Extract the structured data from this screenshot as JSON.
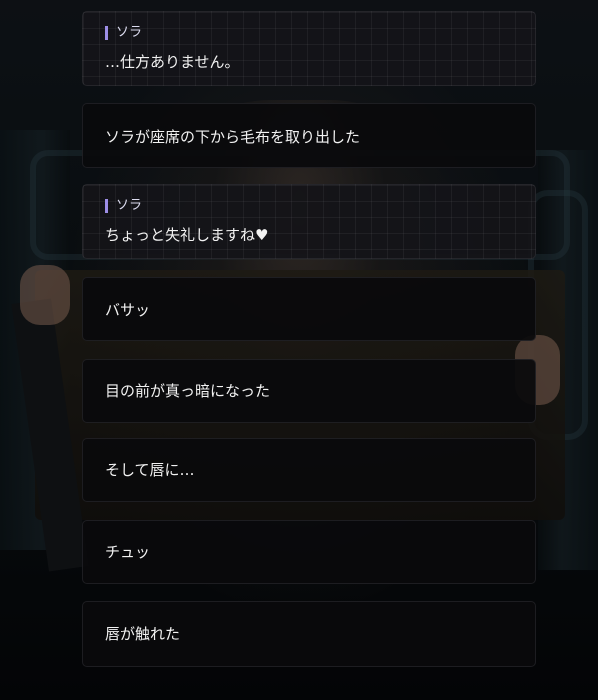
{
  "backlog": [
    {
      "speaker": "ソラ",
      "text": "…仕方ありません。"
    },
    {
      "speaker": "",
      "text": "ソラが座席の下から毛布を取り出した"
    },
    {
      "speaker": "ソラ",
      "text": "ちょっと失礼しますね♥"
    },
    {
      "speaker": "",
      "text": "バサッ"
    },
    {
      "speaker": "",
      "text": "目の前が真っ暗になった"
    },
    {
      "speaker": "",
      "text": "そして唇に…"
    },
    {
      "speaker": "",
      "text": "チュッ"
    },
    {
      "speaker": "",
      "text": "唇が触れた"
    }
  ],
  "colors": {
    "name_marker": "#9d8ee6",
    "card_bg": "#0a0a0c",
    "text": "#f2f2f2"
  }
}
